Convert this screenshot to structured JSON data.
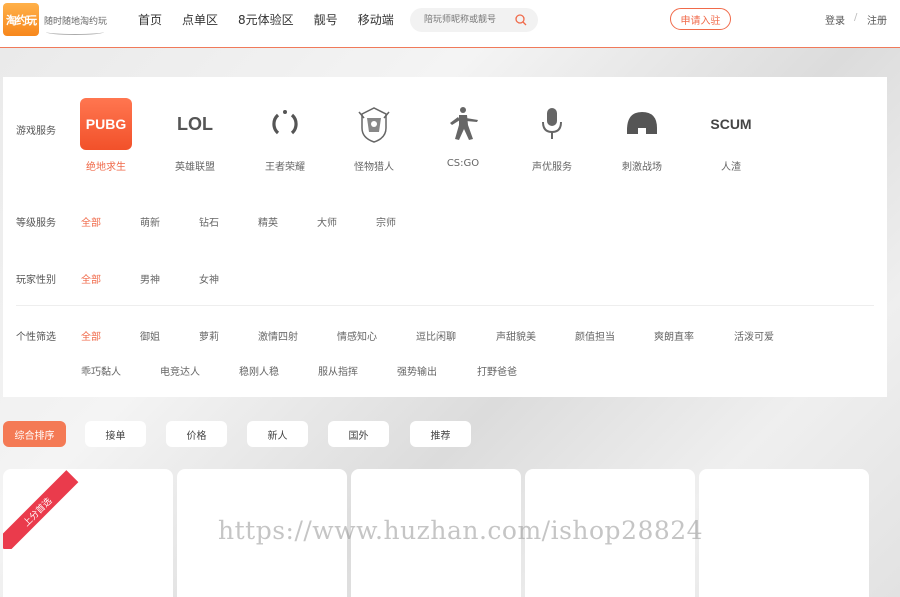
{
  "header": {
    "logo_text": "淘约玩",
    "slogan": "随时随地淘约玩",
    "nav": [
      "首页",
      "点单区",
      "8元体验区",
      "靓号",
      "移动端"
    ],
    "search_placeholder": "陪玩师昵称或靓号",
    "apply_label": "申请入驻",
    "login_label": "登录",
    "separator": "/",
    "register_label": "注册"
  },
  "filters": {
    "game_label": "游戏服务",
    "games": [
      {
        "name": "绝地求生",
        "icon": "pubg-icon",
        "logo_text": "PUBG",
        "active": true
      },
      {
        "name": "英雄联盟",
        "icon": "lol-icon",
        "logo_text": "LOL"
      },
      {
        "name": "王者荣耀",
        "icon": "honor-of-kings-icon"
      },
      {
        "name": "怪物猎人",
        "icon": "monster-hunter-icon"
      },
      {
        "name": "CS:GO",
        "icon": "csgo-icon"
      },
      {
        "name": "声优服务",
        "icon": "microphone-icon"
      },
      {
        "name": "刺激战场",
        "icon": "helmet-icon"
      },
      {
        "name": "人渣",
        "icon": "scum-icon",
        "logo_text": "SCUM"
      }
    ],
    "level_label": "等级服务",
    "levels": [
      "全部",
      "萌新",
      "钻石",
      "精英",
      "大师",
      "宗师"
    ],
    "gender_label": "玩家性别",
    "genders": [
      "全部",
      "男神",
      "女神"
    ],
    "personal_label": "个性筛选",
    "personal_row1": [
      "全部",
      "御姐",
      "萝莉",
      "激情四射",
      "情感知心",
      "逗比闲聊",
      "声甜貌美",
      "颜值担当",
      "爽朗直率",
      "活泼可爱"
    ],
    "personal_row2": [
      "乖巧黏人",
      "电竞达人",
      "稳刚人稳",
      "服从指挥",
      "强势输出",
      "打野爸爸"
    ]
  },
  "sort_tabs": [
    "综合排序",
    "接单",
    "价格",
    "新人",
    "国外",
    "推荐"
  ],
  "cards": {
    "ribbon_text": "上分首选"
  },
  "watermark": "https://www.huzhan.com/ishop28824",
  "colors": {
    "accent": "#f06a4a",
    "ribbon": "#ea3b4c"
  }
}
